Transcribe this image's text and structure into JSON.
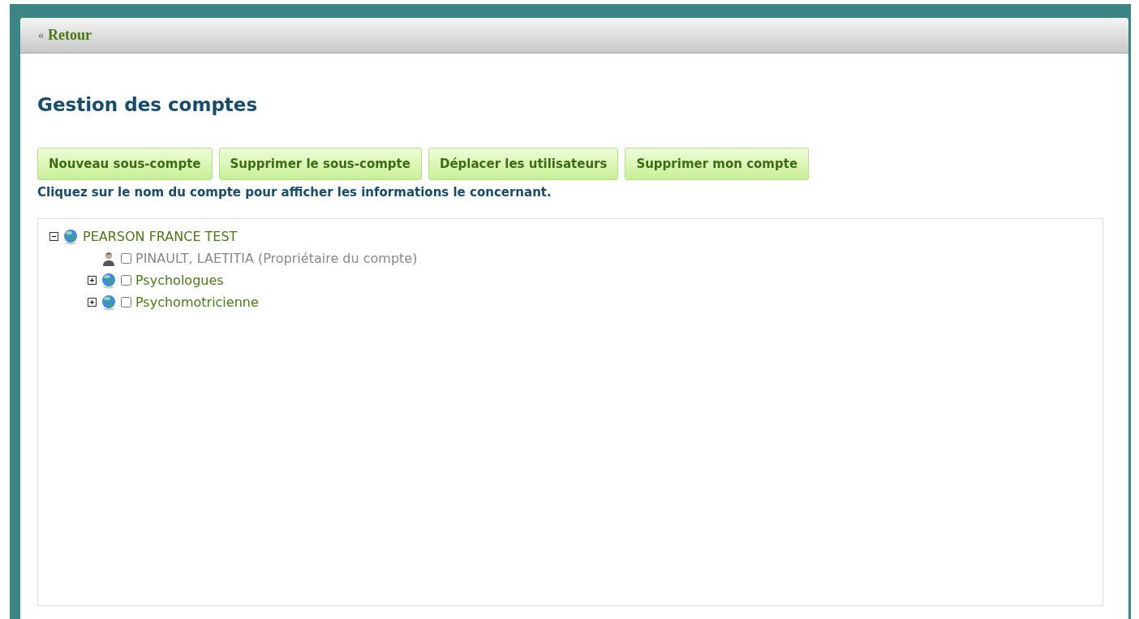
{
  "back_link": {
    "arrow": "«",
    "label": "Retour"
  },
  "title": "Gestion des comptes",
  "buttons": [
    "Nouveau sous-compte",
    "Supprimer le sous-compte",
    "Déplacer les utilisateurs",
    "Supprimer mon compte"
  ],
  "hint": "Cliquez sur le nom du compte pour afficher les informations le concernant.",
  "tree": [
    {
      "kind": "group",
      "label": "PEARSON FRANCE TEST",
      "expanded": true,
      "children": [
        {
          "kind": "user",
          "label": "PINAULT, LAETITIA (Propriétaire du compte)",
          "checked": false
        },
        {
          "kind": "group",
          "label": "Psychologues",
          "expanded": false,
          "checked": false
        },
        {
          "kind": "group",
          "label": "Psychomotricienne",
          "expanded": false,
          "checked": false
        }
      ]
    }
  ]
}
